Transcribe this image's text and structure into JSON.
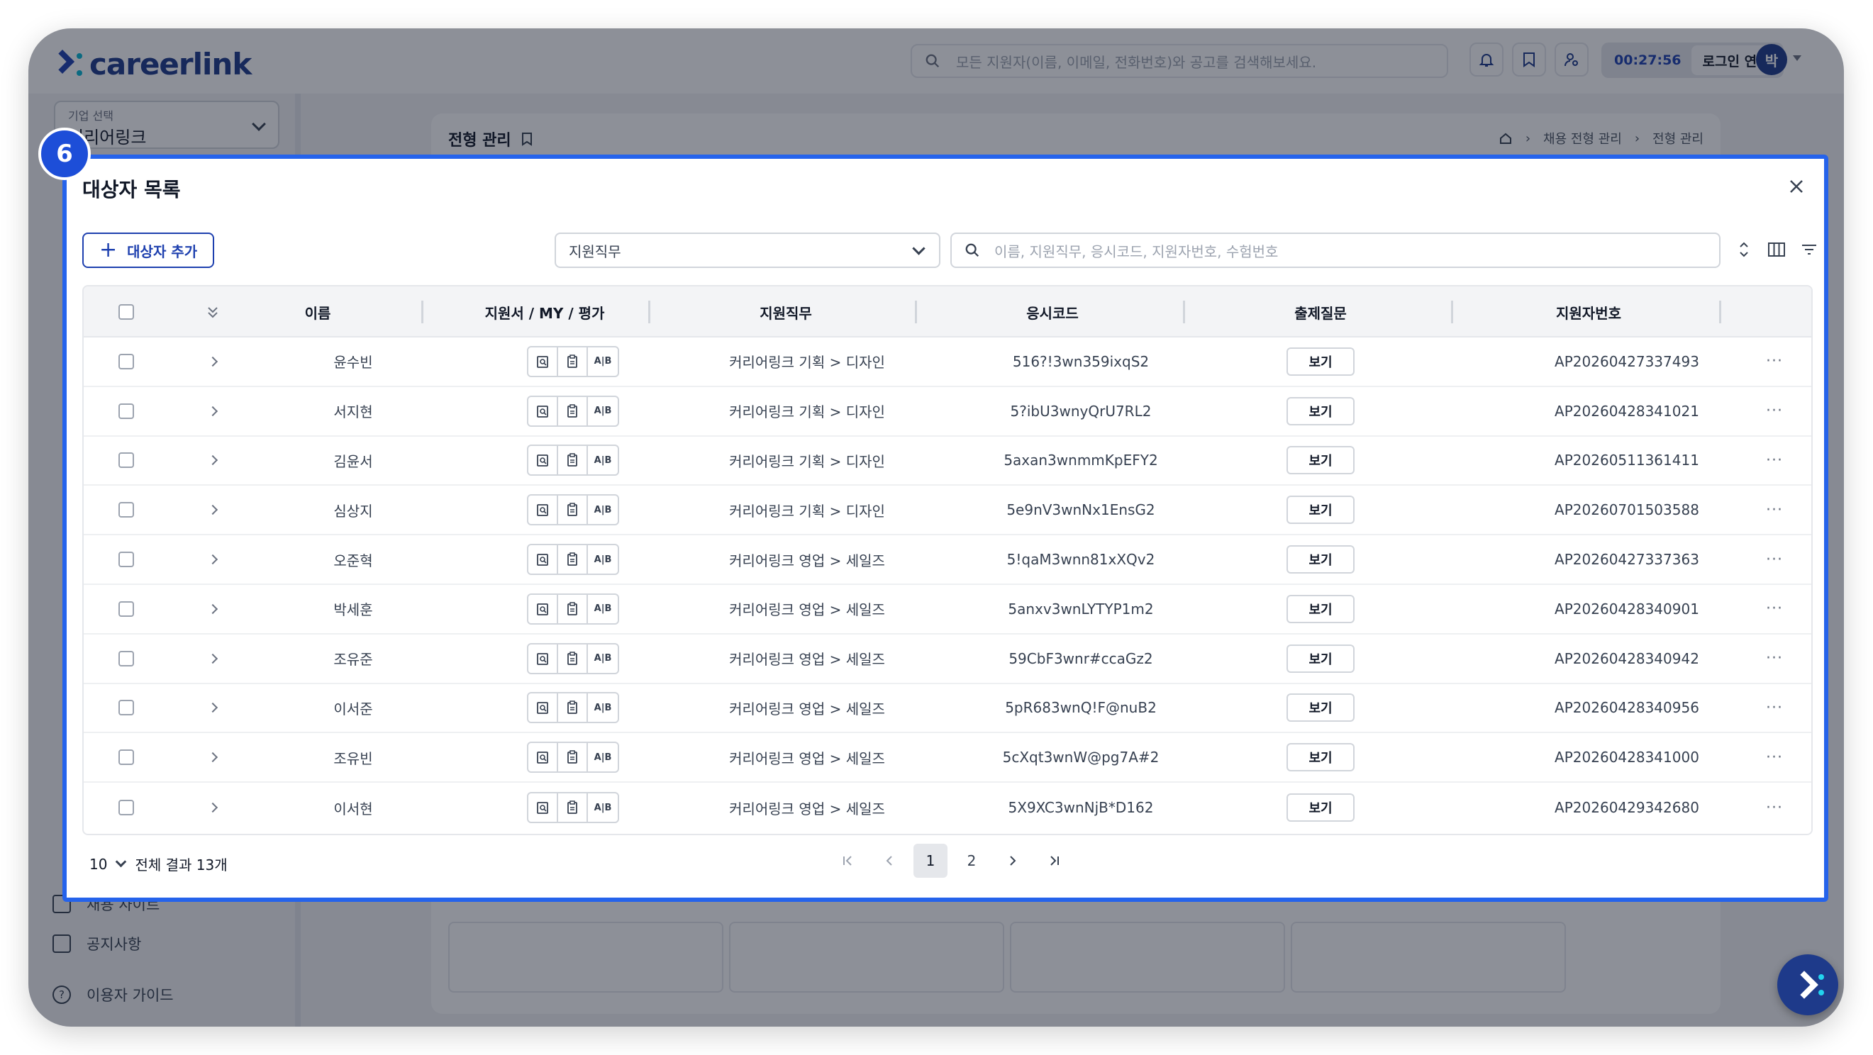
{
  "app": {
    "logo_text": "careerlink",
    "search_placeholder": "모든 지원자(이름, 이메일, 전화번호)와 공고를 검색해보세요.",
    "session_timer": "00:27:56",
    "extend_label": "로그인 연장",
    "avatar_initial": "박"
  },
  "sidebar": {
    "company_caption": "기업 선택",
    "company_value": "커리어링크",
    "items": [
      {
        "label": "채용 사이트",
        "icon": "calendar-icon"
      },
      {
        "label": "공지사항",
        "icon": "megaphone-icon"
      },
      {
        "label": "이용자 가이드",
        "icon": "help-icon"
      }
    ]
  },
  "page": {
    "title": "전형 관리",
    "breadcrumb": [
      "채용 전형 관리",
      "전형 관리"
    ]
  },
  "step_badge": "6",
  "modal": {
    "title": "대상자 목록",
    "add_button": "대상자 추가",
    "job_select_value": "지원직무",
    "search_placeholder": "이름, 지원직무, 응시코드, 지원자번호, 수험번호",
    "columns": [
      "이름",
      "지원서 / MY / 평가",
      "지원직무",
      "응시코드",
      "출제질문",
      "지원자번호"
    ],
    "view_label": "보기",
    "ab_label": "A|B",
    "rows": [
      {
        "name": "윤수빈",
        "job": "커리어링크 기획 > 디자인",
        "code": "516?!3wn359ixqS2",
        "applicant_no": "AP20260427337493"
      },
      {
        "name": "서지현",
        "job": "커리어링크 기획 > 디자인",
        "code": "5?ibU3wnyQrU7RL2",
        "applicant_no": "AP20260428341021"
      },
      {
        "name": "김윤서",
        "job": "커리어링크 기획 > 디자인",
        "code": "5axan3wnmmKpEFY2",
        "applicant_no": "AP20260511361411"
      },
      {
        "name": "심상지",
        "job": "커리어링크 기획 > 디자인",
        "code": "5e9nV3wnNx1EnsG2",
        "applicant_no": "AP20260701503588"
      },
      {
        "name": "오준혁",
        "job": "커리어링크 영업 > 세일즈",
        "code": "5!qaM3wnn81xXQv2",
        "applicant_no": "AP20260427337363"
      },
      {
        "name": "박세훈",
        "job": "커리어링크 영업 > 세일즈",
        "code": "5anxv3wnLYTYP1m2",
        "applicant_no": "AP20260428340901"
      },
      {
        "name": "조유준",
        "job": "커리어링크 영업 > 세일즈",
        "code": "59CbF3wnr#ccaGz2",
        "applicant_no": "AP20260428340942"
      },
      {
        "name": "이서준",
        "job": "커리어링크 영업 > 세일즈",
        "code": "5pR683wnQ!F@nuB2",
        "applicant_no": "AP20260428340956"
      },
      {
        "name": "조유빈",
        "job": "커리어링크 영업 > 세일즈",
        "code": "5cXqt3wnW@pg7A#2",
        "applicant_no": "AP20260428341000"
      },
      {
        "name": "이서현",
        "job": "커리어링크 영업 > 세일즈",
        "code": "5X9XC3wnNjB*D162",
        "applicant_no": "AP20260429342680"
      }
    ],
    "footer": {
      "page_size": "10",
      "total_label": "전체 결과 13개",
      "pages": [
        "1",
        "2"
      ],
      "current_page": "1"
    }
  },
  "colors": {
    "brand": "#1e3a8a",
    "accent": "#2563eb",
    "cyan": "#06b6d4"
  }
}
